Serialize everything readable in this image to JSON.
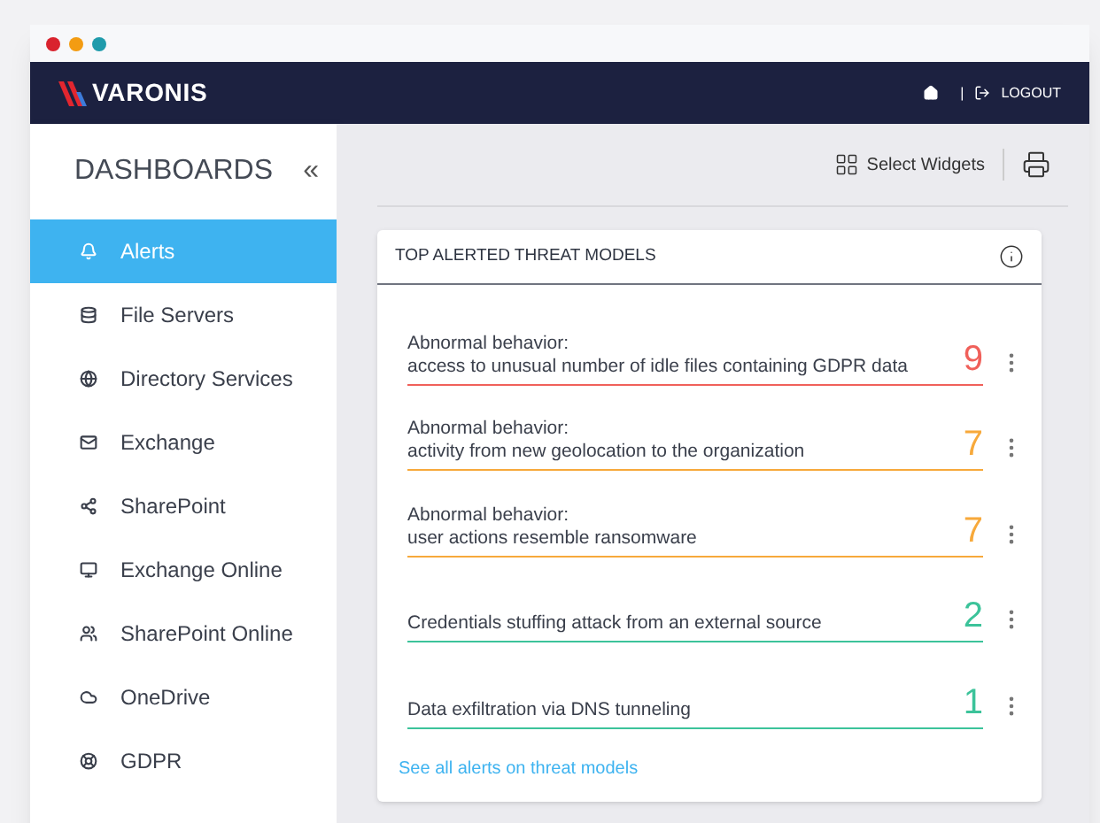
{
  "brand": "VARONIS",
  "nav": {
    "logout": "LOGOUT",
    "separator": "|"
  },
  "sidebar": {
    "title": "DASHBOARDS",
    "collapse": "«",
    "items": [
      {
        "label": "Alerts",
        "selected": true
      },
      {
        "label": "File Servers",
        "selected": false
      },
      {
        "label": "Directory Services",
        "selected": false
      },
      {
        "label": "Exchange",
        "selected": false
      },
      {
        "label": "SharePoint",
        "selected": false
      },
      {
        "label": "Exchange Online",
        "selected": false
      },
      {
        "label": "SharePoint Online",
        "selected": false
      },
      {
        "label": "OneDrive",
        "selected": false
      },
      {
        "label": "GDPR",
        "selected": false
      }
    ]
  },
  "toolbar": {
    "select_widgets": "Select Widgets"
  },
  "widget": {
    "title": "TOP ALERTED THREAT MODELS",
    "rows": [
      {
        "lines": [
          "Abnormal behavior:",
          "access to unusual number of idle files containing GDPR data"
        ],
        "count": "9",
        "color": "#f0605a"
      },
      {
        "lines": [
          "Abnormal behavior:",
          "activity from new geolocation to the organization"
        ],
        "count": "7",
        "color": "#f7a93b"
      },
      {
        "lines": [
          "Abnormal behavior:",
          "user actions resemble ransomware"
        ],
        "count": "7",
        "color": "#f7a93b"
      },
      {
        "lines": [
          "Credentials stuffing attack from an external source"
        ],
        "count": "2",
        "color": "#3cc39a"
      },
      {
        "lines": [
          "Data exfiltration via DNS tunneling"
        ],
        "count": "1",
        "color": "#3cc39a"
      }
    ],
    "link": "See all alerts on threat models"
  }
}
